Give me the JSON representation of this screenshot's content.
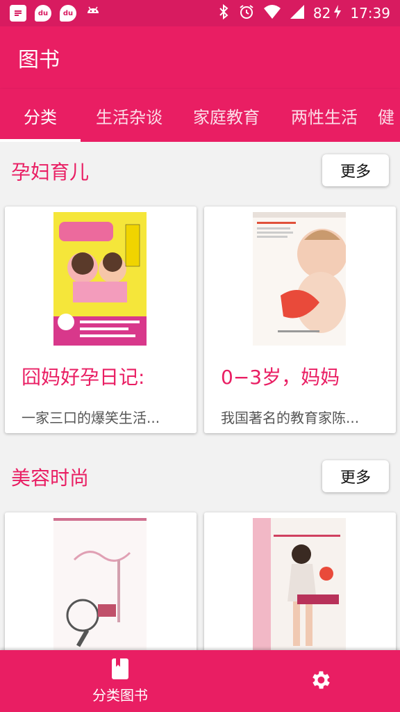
{
  "status_bar": {
    "battery": "82",
    "time": "17:39",
    "notif_icons": [
      "document-icon",
      "du-icon",
      "du-icon",
      "android-icon"
    ],
    "notif_label": "du"
  },
  "app_bar": {
    "title": "图书"
  },
  "tabs": [
    {
      "label": "分类",
      "selected": true
    },
    {
      "label": "生活杂谈"
    },
    {
      "label": "家庭教育"
    },
    {
      "label": "两性生活"
    },
    {
      "label": "健"
    }
  ],
  "sections": [
    {
      "title": "孕妇育儿",
      "more_label": "更多",
      "books": [
        {
          "title": "囧妈好孕日记:",
          "desc": "一家三口的爆笑生活..."
        },
        {
          "title": "0−3岁，妈妈",
          "desc": "我国著名的教育家陈..."
        }
      ]
    },
    {
      "title": "美容时尚",
      "more_label": "更多",
      "books": [
        {
          "title": "",
          "desc": ""
        },
        {
          "title": "",
          "desc": ""
        }
      ]
    }
  ],
  "bottom_nav": {
    "books_label": "分类图书"
  },
  "colors": {
    "primary": "#e91e63",
    "status": "#d81b60",
    "background": "#f2f2f2"
  }
}
